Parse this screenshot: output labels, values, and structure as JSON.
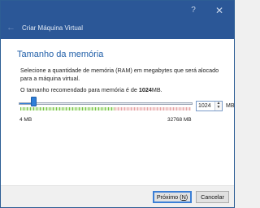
{
  "window": {
    "help_glyph": "?",
    "close_glyph": "✕",
    "back_glyph": "←",
    "wizard_title": "Criar Máquina Virtual",
    "icons": {
      "help": "help-icon",
      "close": "close-icon",
      "back": "back-arrow-icon"
    }
  },
  "page": {
    "heading": "Tamanho da memória",
    "description": "Selecione a quantidade de memória (RAM) em megabytes que será alocado para a máquina virtual.",
    "recommend_prefix": "O tamanho recomendado para memória é de ",
    "recommend_value": "1024",
    "recommend_suffix": "MB."
  },
  "memory": {
    "value": "1024",
    "unit": "MB",
    "min_label": "4 MB",
    "max_label": "32768 MB",
    "min": 4,
    "max": 32768,
    "current": 1024,
    "spin_up_glyph": "▲",
    "spin_down_glyph": "▼",
    "colors": {
      "slider_accent": "#2f7fd8",
      "safe_zone": "#75c043",
      "unsafe_zone": "#e3a3a3"
    }
  },
  "buttons": {
    "next_prefix": "Próximo (",
    "next_mnemonic": "N",
    "next_suffix": ")",
    "cancel": "Cancelar"
  },
  "colors": {
    "titlebar": "#2b5797",
    "heading": "#1f5ea8"
  }
}
